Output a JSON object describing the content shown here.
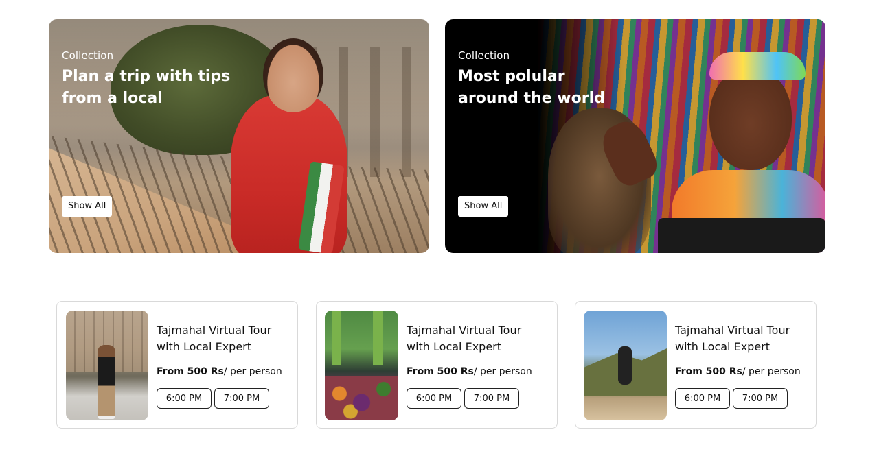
{
  "collections": [
    {
      "kicker": "Collection",
      "title": "Plan a trip with tips from a local",
      "button": "Show All"
    },
    {
      "kicker": "Collection",
      "title": "Most polular around the world",
      "button": "Show All"
    }
  ],
  "tours": [
    {
      "title": "Tajmahal Virtual Tour with Local Expert",
      "price_bold": "From 500 Rs",
      "price_suffix": "/ per person",
      "times": [
        "6:00 PM",
        "7:00 PM"
      ]
    },
    {
      "title": "Tajmahal Virtual Tour with Local Expert",
      "price_bold": "From 500 Rs",
      "price_suffix": "/ per person",
      "times": [
        "6:00 PM",
        "7:00 PM"
      ]
    },
    {
      "title": "Tajmahal Virtual Tour with Local Expert",
      "price_bold": "From 500 Rs",
      "price_suffix": "/ per person",
      "times": [
        "6:00 PM",
        "7:00 PM"
      ]
    }
  ]
}
